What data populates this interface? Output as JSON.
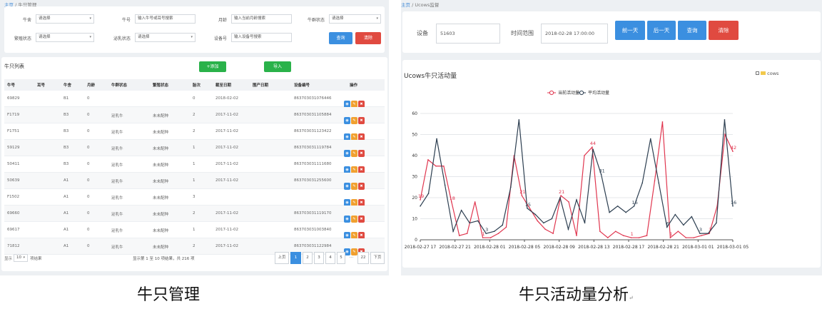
{
  "left": {
    "breadcrumb": {
      "home": "主页",
      "sep": " / ",
      "current": "牛只管理"
    },
    "filters": [
      {
        "label": "牛舍",
        "value": "请选择",
        "type": "select"
      },
      {
        "label": "牛号",
        "value": "输入牛号或耳号搜索",
        "type": "input"
      },
      {
        "label": "月龄",
        "value": "输入当前月龄搜索",
        "type": "input"
      },
      {
        "label": "牛群状态",
        "value": "请选择",
        "type": "select"
      },
      {
        "label": "繁殖状态",
        "value": "请选择",
        "type": "select"
      },
      {
        "label": "泌乳状态",
        "value": "请选择",
        "type": "select"
      },
      {
        "label": "设备号",
        "value": "输入设备号搜索",
        "type": "input"
      }
    ],
    "buttons": {
      "query": "查询",
      "reset": "清除"
    },
    "list_title": "牛只列表",
    "add_label": "+添加",
    "import_label": "导入",
    "columns": [
      "牛号",
      "耳号",
      "牛舍",
      "月龄",
      "牛群状态",
      "繁殖状态",
      "胎次",
      "截至日期",
      "围产日期",
      "设备编号",
      "操作"
    ],
    "rows": [
      [
        "69829",
        "",
        "B1",
        "0",
        "",
        "",
        "0",
        "2018-02-02",
        "",
        "863703031076446"
      ],
      [
        "F1719",
        "",
        "B3",
        "0",
        "泌乳牛",
        "未未配种",
        "2",
        "2017-11-02",
        "",
        "863703031105884"
      ],
      [
        "F1751",
        "",
        "B3",
        "0",
        "泌乳牛",
        "未未配种",
        "2",
        "2017-11-02",
        "",
        "863703031123422"
      ],
      [
        "59129",
        "",
        "B3",
        "0",
        "泌乳牛",
        "未未配种",
        "1",
        "2017-11-02",
        "",
        "863703031119784"
      ],
      [
        "50411",
        "",
        "B3",
        "0",
        "泌乳牛",
        "未未配种",
        "1",
        "2017-11-02",
        "",
        "863703031111680"
      ],
      [
        "50639",
        "",
        "A1",
        "0",
        "泌乳牛",
        "未未配种",
        "1",
        "2017-11-02",
        "",
        "863703031255600"
      ],
      [
        "F1502",
        "",
        "A1",
        "0",
        "泌乳牛",
        "未未配种",
        "3",
        "",
        "",
        ""
      ],
      [
        "69660",
        "",
        "A1",
        "0",
        "泌乳牛",
        "未未配种",
        "2",
        "2017-11-02",
        "",
        "863703031119170"
      ],
      [
        "69617",
        "",
        "A1",
        "0",
        "泌乳牛",
        "未未配种",
        "1",
        "2017-11-02",
        "",
        "863703031003840"
      ],
      [
        "71812",
        "",
        "A1",
        "0",
        "泌乳牛",
        "未未配种",
        "2",
        "2017-11-02",
        "",
        "863703031122984"
      ]
    ],
    "page_size_prefix": "显示",
    "page_size": "10",
    "page_size_suffix": "项结果",
    "summary": "显示第 1 至 10 项结果，共 216 项",
    "pagination": [
      "上页",
      "1",
      "2",
      "3",
      "4",
      "5",
      "…",
      "22",
      "下页"
    ],
    "op_icons": [
      "view-icon",
      "edit-icon",
      "delete-icon"
    ],
    "colors": {
      "green": "#2ab24a",
      "blue": "#3b8fe0",
      "red": "#e04a40",
      "orange": "#f0a030"
    }
  },
  "right": {
    "breadcrumb": {
      "home": "主页",
      "sep": " / ",
      "current": "Ucows监督"
    },
    "device_label": "设备",
    "device_value": "51603",
    "time_label": "时间范围",
    "time_value": "2018-02-28 17:00:00",
    "buttons": {
      "prev": "前一天",
      "next": "后一天",
      "query": "查询",
      "reset": "清除"
    },
    "chart_title": "Ucows牛只活动量",
    "corner_legend": "cows"
  },
  "captions": {
    "left": "牛只管理",
    "right": "牛只活动量分析",
    "right_mark": "↵"
  },
  "chart_data": {
    "type": "line",
    "legend": [
      "当前活动量",
      "平均活动量"
    ],
    "x_ticks": [
      "2018-02-27 17",
      "2018-02-27 21",
      "2018-02-28 01",
      "2018-02-28 05",
      "2018-02-28 09",
      "2018-02-28 13",
      "2018-02-28 17",
      "2018-02-28 21",
      "2018-03-01 01",
      "2018-03-01 05"
    ],
    "ylim": [
      0,
      60
    ],
    "y_ticks": [
      0,
      10,
      20,
      30,
      40,
      50,
      60
    ],
    "grid": true,
    "legend_position": "top-center",
    "series": [
      {
        "name": "当前活动量",
        "color": "#e0364f",
        "values": [
          19,
          38,
          35,
          35,
          18,
          2,
          3,
          18,
          1,
          1,
          3,
          6,
          40,
          21,
          15,
          9,
          5,
          3,
          21,
          18,
          2,
          40,
          44,
          4,
          1,
          4,
          2,
          1,
          1,
          2,
          28,
          56,
          1,
          4,
          1,
          1,
          2,
          3,
          16,
          50,
          42
        ],
        "labels": {
          "0": "19",
          "4": "18",
          "8": "1",
          "13": "21",
          "18": "21",
          "22": "44",
          "27": "1",
          "32": "1",
          "37": "3",
          "40": "42"
        }
      },
      {
        "name": "平均活动量",
        "color": "#2c3e50",
        "values": [
          16,
          22,
          48,
          26,
          4,
          14,
          8,
          9,
          3,
          4,
          7,
          25,
          57,
          15,
          12,
          8,
          10,
          20,
          5,
          19,
          8,
          43,
          31,
          13,
          16,
          13,
          16,
          27,
          48,
          27,
          6,
          12,
          7,
          11,
          3,
          3,
          8,
          57,
          16
        ],
        "labels": {
          "8": "3",
          "13": "15",
          "22": "31",
          "26": "16",
          "30": "6",
          "34": "3",
          "38": "16"
        }
      }
    ]
  }
}
